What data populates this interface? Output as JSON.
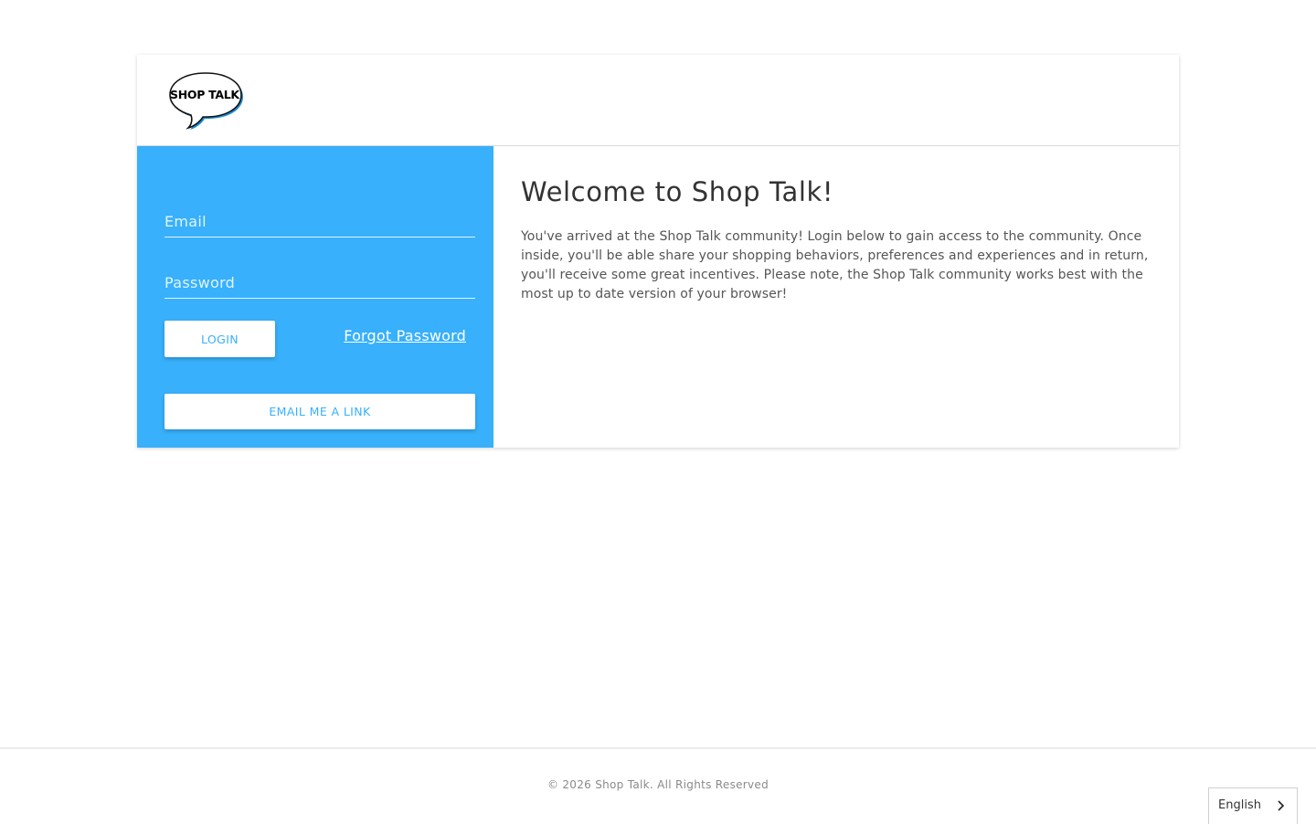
{
  "brand": {
    "logo_text": "SHOP TALK",
    "accent": "#38b0fb"
  },
  "login": {
    "email_placeholder": "Email",
    "password_placeholder": "Password",
    "login_label": "LOGIN",
    "forgot_label": "Forgot Password",
    "email_link_label": "EMAIL ME A LINK"
  },
  "welcome": {
    "title": "Welcome to Shop Talk!",
    "body": "You've arrived at the Shop Talk community! Login below to gain access to the community. Once inside, you'll be able share your shopping behaviors, preferences and experiences and in return, you'll receive some great incentives. Please note, the Shop Talk community works best with the most up to date version of your browser!"
  },
  "footer": {
    "copyright": "© 2026 Shop Talk. All Rights Reserved",
    "language": "English"
  }
}
